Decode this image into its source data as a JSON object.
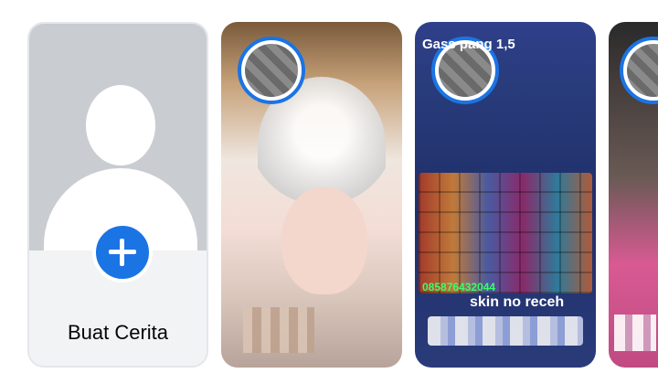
{
  "stories": {
    "create": {
      "label": "Buat Cerita"
    },
    "items": [
      {
        "title": "",
        "caption": ""
      },
      {
        "title": "Gass pang 1,5",
        "phone": "085876432044",
        "caption": "skin no receh"
      },
      {
        "title": "",
        "caption": ""
      }
    ]
  },
  "colors": {
    "accent": "#1b74e4",
    "create_card_bg": "#f2f3f5"
  },
  "icons": {
    "create_button": "plus-icon",
    "default_avatar": "user-silhouette-icon"
  }
}
